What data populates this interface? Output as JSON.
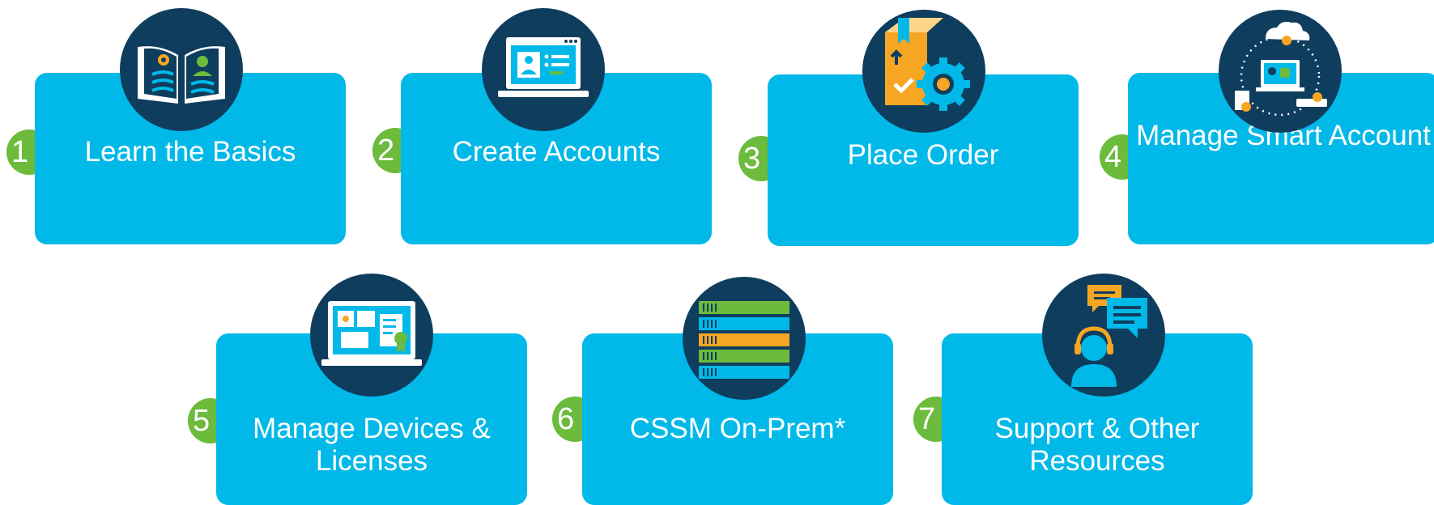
{
  "steps": [
    {
      "number": "1",
      "label": "Learn the Basics",
      "icon": "open-book-icon"
    },
    {
      "number": "2",
      "label": "Create Accounts",
      "icon": "laptop-profile-icon"
    },
    {
      "number": "3",
      "label": "Place Order",
      "icon": "package-gear-icon"
    },
    {
      "number": "4",
      "label": "Manage Smart Account",
      "icon": "cloud-account-cycle-icon"
    },
    {
      "number": "5",
      "label": "Manage Devices & Licenses",
      "icon": "laptop-license-icon"
    },
    {
      "number": "6",
      "label": "CSSM On-Prem*",
      "icon": "server-stack-icon"
    },
    {
      "number": "7",
      "label": "Support & Other Resources",
      "icon": "support-chat-icon"
    }
  ],
  "colors": {
    "card": "#00b9e8",
    "number_badge": "#6cbb3c",
    "icon_circle": "#0f3d5e",
    "accent_orange": "#f6a623",
    "accent_green": "#6cbb3c"
  }
}
